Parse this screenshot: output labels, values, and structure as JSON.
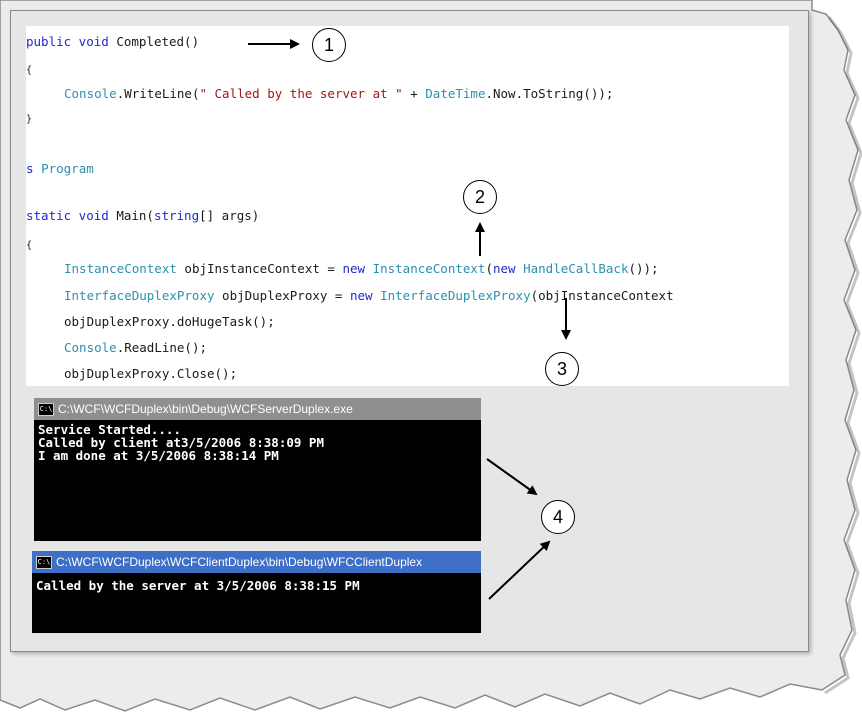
{
  "code": {
    "line1_kw": "public void",
    "line1_rest": " Completed()",
    "brace_open_1": "{",
    "line3_type": "Console",
    "line3_method": ".WriteLine(",
    "line3_string": "\" Called by the server at \"",
    "line3_plus": " + ",
    "line3_type2": "DateTime",
    "line3_rest": ".Now.ToString());",
    "brace_close_1": "}",
    "line5_kw": "s",
    "line5_type": "Program",
    "line6_kw": "static void",
    "line6_mid": " Main(",
    "line6_kw2": "string",
    "line6_rest": "[] args)",
    "brace_open_2": "{",
    "line8_type": "InstanceContext",
    "line8_mid": " objInstanceContext = ",
    "line8_kw": "new",
    "line8_type2": "InstanceContext",
    "line8_mid2": "(",
    "line8_kw2": "new",
    "line8_type3": "HandleCallBack",
    "line8_rest": "());",
    "line9_type": "InterfaceDuplexProxy",
    "line9_mid": " objDuplexProxy = ",
    "line9_kw": "new",
    "line9_type2": "InterfaceDuplexProxy",
    "line9_rest": "(objInstanceContext",
    "line10": "objDuplexProxy.doHugeTask();",
    "line11_type": "Console",
    "line11_rest": ".ReadLine();",
    "line12": "objDuplexProxy.Close();"
  },
  "callouts": [
    "1",
    "2",
    "3",
    "4"
  ],
  "server_console": {
    "title": "C:\\WCF\\WCFDuplex\\bin\\Debug\\WCFServerDuplex.exe",
    "icon": "cmd-icon",
    "lines": [
      "Service Started....",
      "Called by client at3/5/2006 8:38:09 PM",
      "I am done at 3/5/2006 8:38:14 PM"
    ]
  },
  "client_console": {
    "title": "C:\\WCF\\WCFDuplex\\WCFClientDuplex\\bin\\Debug\\WFCClientDuplex",
    "icon": "cmd-icon",
    "lines": [
      "Called by the server at 3/5/2006 8:38:15 PM"
    ]
  },
  "colors": {
    "keyword": "#1f2ad0",
    "type": "#2b91af",
    "string": "#a31515",
    "server_titlebar": "#8f8f8f",
    "client_titlebar": "#3e6fc7"
  }
}
